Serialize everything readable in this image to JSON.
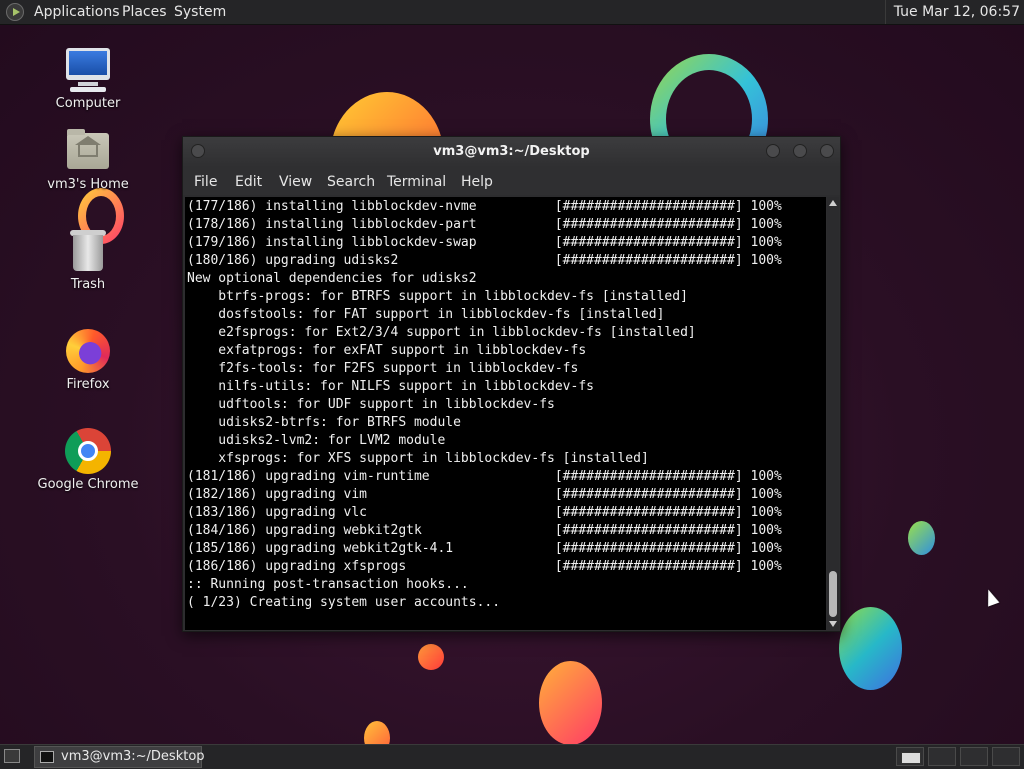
{
  "top_panel": {
    "menu": [
      "Applications",
      "Places",
      "System"
    ],
    "clock": "Tue Mar 12, 06:57"
  },
  "desktop": {
    "icons": [
      {
        "label": "Computer",
        "icon": "computer-icon"
      },
      {
        "label": "vm3's Home",
        "icon": "home-folder-icon"
      },
      {
        "label": "Trash",
        "icon": "trash-icon"
      },
      {
        "label": "Firefox",
        "icon": "firefox-icon"
      },
      {
        "label": "Google Chrome",
        "icon": "chrome-icon"
      }
    ]
  },
  "terminal": {
    "title": "vm3@vm3:~/Desktop",
    "menu": [
      "File",
      "Edit",
      "View",
      "Search",
      "Terminal",
      "Help"
    ],
    "lines": [
      "(177/186) installing libblockdev-nvme          [######################] 100%",
      "(178/186) installing libblockdev-part          [######################] 100%",
      "(179/186) installing libblockdev-swap          [######################] 100%",
      "(180/186) upgrading udisks2                    [######################] 100%",
      "New optional dependencies for udisks2",
      "    btrfs-progs: for BTRFS support in libblockdev-fs [installed]",
      "    dosfstools: for FAT support in libblockdev-fs [installed]",
      "    e2fsprogs: for Ext2/3/4 support in libblockdev-fs [installed]",
      "    exfatprogs: for exFAT support in libblockdev-fs",
      "    f2fs-tools: for F2FS support in libblockdev-fs",
      "    nilfs-utils: for NILFS support in libblockdev-fs",
      "    udftools: for UDF support in libblockdev-fs",
      "    udisks2-btrfs: for BTRFS module",
      "    udisks2-lvm2: for LVM2 module",
      "    xfsprogs: for XFS support in libblockdev-fs [installed]",
      "(181/186) upgrading vim-runtime                [######################] 100%",
      "(182/186) upgrading vim                        [######################] 100%",
      "(183/186) upgrading vlc                        [######################] 100%",
      "(184/186) upgrading webkit2gtk                 [######################] 100%",
      "(185/186) upgrading webkit2gtk-4.1             [######################] 100%",
      "(186/186) upgrading xfsprogs                   [######################] 100%",
      ":: Running post-transaction hooks...",
      "( 1/23) Creating system user accounts..."
    ]
  },
  "taskbar": {
    "task_label": "vm3@vm3:~/Desktop"
  }
}
